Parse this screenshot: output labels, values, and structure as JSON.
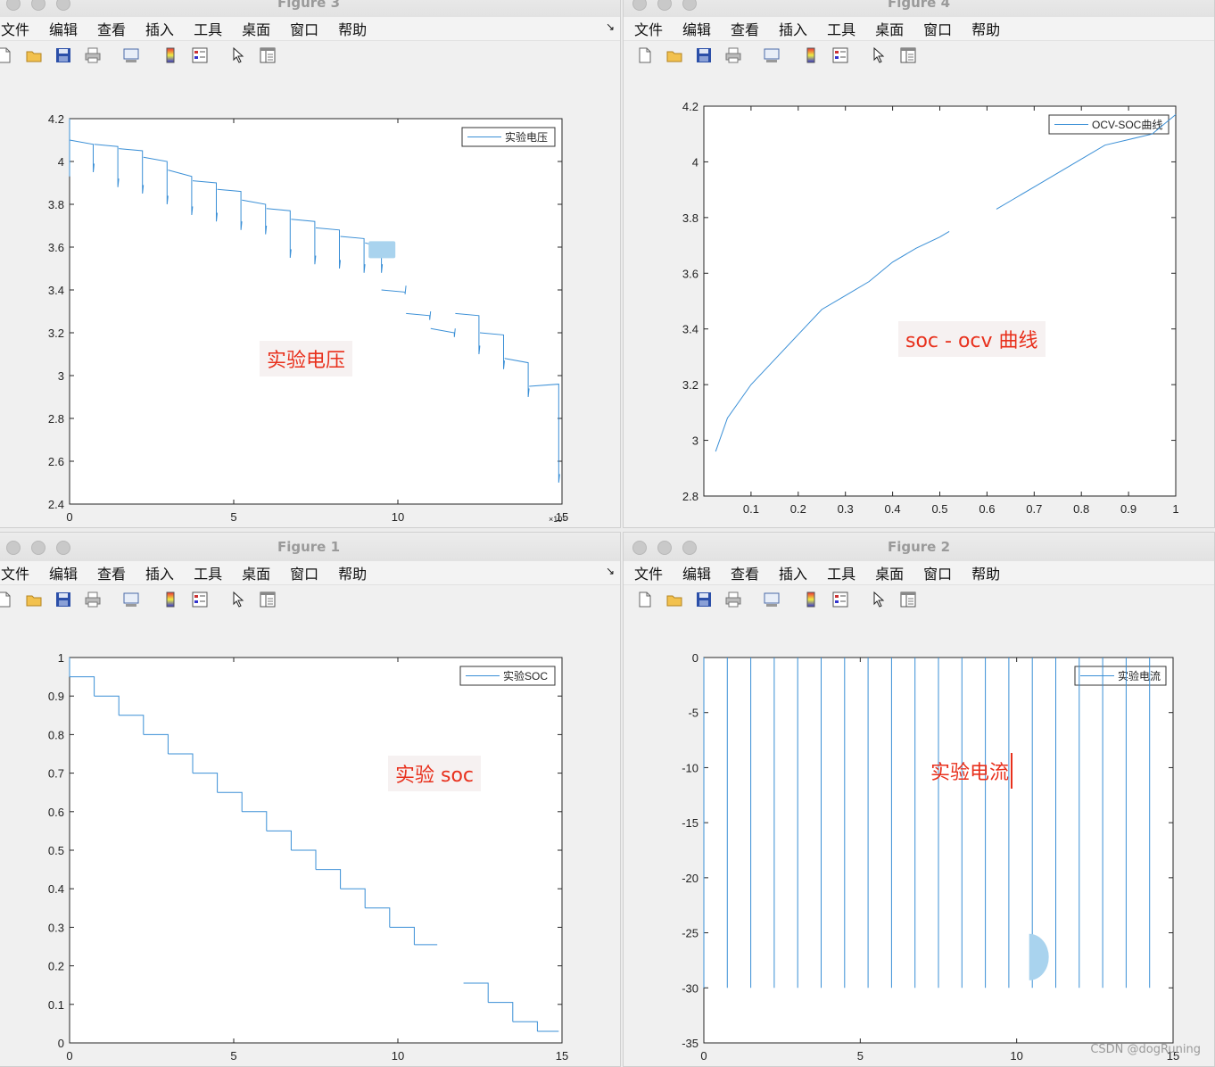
{
  "menu": [
    "文件",
    "编辑",
    "查看",
    "插入",
    "工具",
    "桌面",
    "窗口",
    "帮助"
  ],
  "dock_icon": "↘",
  "toolbar_icons": [
    "new-file-icon",
    "open-folder-icon",
    "save-icon",
    "print-icon",
    "link-icon",
    "colorbar-icon",
    "legend-icon",
    "pointer-icon",
    "property-icon"
  ],
  "colors": {
    "line": "#3a8fd6",
    "annotation": "#e8301c",
    "title": "#9a9a9a"
  },
  "windows": [
    {
      "id": "fig3",
      "title": "Figure 3",
      "legend": "实验电压",
      "annotation": "实验电压",
      "exponent": "×10⁵"
    },
    {
      "id": "fig4",
      "title": "Figure 4",
      "legend": "OCV-SOC曲线",
      "annotation": "soc - ocv 曲线"
    },
    {
      "id": "fig1",
      "title": "Figure 1",
      "legend": "实验SOC",
      "annotation": "实验 soc"
    },
    {
      "id": "fig2",
      "title": "Figure 2",
      "legend": "实验电流",
      "annotation": "实验电流"
    }
  ],
  "watermark": "CSDN @dogRuning",
  "chart_data": [
    {
      "type": "line",
      "figure": "Figure 3",
      "xlim": [
        0,
        15
      ],
      "ylim": [
        2.4,
        4.2
      ],
      "xticks": [
        "0",
        "5",
        "10",
        "15"
      ],
      "yticks": [
        "2.4",
        "2.6",
        "2.8",
        "3",
        "3.2",
        "3.4",
        "3.6",
        "3.8",
        "4",
        "4.2"
      ],
      "series": [
        {
          "name": "实验电压",
          "pulses": [
            [
              0.0,
              4.1,
              4.08,
              3.95
            ],
            [
              0.75,
              4.08,
              4.07,
              3.88
            ],
            [
              1.5,
              4.06,
              4.05,
              3.85
            ],
            [
              2.25,
              4.02,
              4.0,
              3.8
            ],
            [
              3.0,
              3.96,
              3.93,
              3.75
            ],
            [
              3.75,
              3.91,
              3.9,
              3.72
            ],
            [
              4.5,
              3.87,
              3.86,
              3.68
            ],
            [
              5.25,
              3.82,
              3.8,
              3.66
            ],
            [
              6.0,
              3.78,
              3.77,
              3.55
            ],
            [
              6.75,
              3.73,
              3.72,
              3.52
            ],
            [
              7.5,
              3.69,
              3.68,
              3.5
            ],
            [
              8.25,
              3.65,
              3.64,
              3.48
            ],
            [
              9.0,
              3.62,
              3.6,
              3.48
            ],
            [
              9.5,
              3.4,
              3.39,
              3.38
            ],
            [
              10.25,
              3.29,
              3.28,
              3.26
            ],
            [
              11.0,
              3.22,
              3.2,
              3.18
            ],
            [
              11.75,
              3.29,
              3.28,
              3.1
            ],
            [
              12.5,
              3.2,
              3.19,
              3.03
            ],
            [
              13.25,
              3.08,
              3.06,
              2.9
            ],
            [
              14.0,
              2.95,
              2.96,
              2.5
            ]
          ]
        }
      ]
    },
    {
      "type": "line",
      "figure": "Figure 4",
      "xlim": [
        0,
        1
      ],
      "ylim": [
        2.8,
        4.2
      ],
      "xticks": [
        "0.1",
        "0.2",
        "0.3",
        "0.4",
        "0.5",
        "0.6",
        "0.7",
        "0.8",
        "0.9",
        "1"
      ],
      "yticks": [
        "2.8",
        "3",
        "3.2",
        "3.4",
        "3.6",
        "3.8",
        "4",
        "4.2"
      ],
      "series": [
        {
          "name": "OCV-SOC曲线",
          "x": [
            0.025,
            0.05,
            0.1,
            0.15,
            0.2,
            0.25,
            0.3,
            0.35,
            0.4,
            0.45,
            0.5,
            0.52
          ],
          "y": [
            2.96,
            3.08,
            3.2,
            3.29,
            3.38,
            3.47,
            3.52,
            3.57,
            3.64,
            3.69,
            3.73,
            3.75
          ],
          "x2": [
            0.62,
            0.65,
            0.7,
            0.75,
            0.8,
            0.85,
            0.9,
            0.95,
            1.0
          ],
          "y2": [
            3.83,
            3.86,
            3.91,
            3.96,
            4.01,
            4.06,
            4.08,
            4.1,
            4.17
          ]
        }
      ]
    },
    {
      "type": "line",
      "figure": "Figure 1",
      "xlim": [
        0,
        15
      ],
      "ylim": [
        0,
        1
      ],
      "xticks": [
        "0",
        "5",
        "10",
        "15"
      ],
      "yticks": [
        "0",
        "0.1",
        "0.2",
        "0.3",
        "0.4",
        "0.5",
        "0.6",
        "0.7",
        "0.8",
        "0.9",
        "1"
      ],
      "series": [
        {
          "name": "实验SOC",
          "steps": [
            [
              0,
              0.95
            ],
            [
              0.75,
              0.9
            ],
            [
              1.5,
              0.85
            ],
            [
              2.25,
              0.8
            ],
            [
              3.0,
              0.75
            ],
            [
              3.75,
              0.7
            ],
            [
              4.5,
              0.65
            ],
            [
              5.25,
              0.6
            ],
            [
              6.0,
              0.55
            ],
            [
              6.75,
              0.5
            ],
            [
              7.5,
              0.45
            ],
            [
              8.25,
              0.4
            ],
            [
              9.0,
              0.35
            ],
            [
              9.75,
              0.3
            ],
            [
              10.5,
              0.255
            ],
            [
              11.2,
              null
            ],
            [
              12.0,
              0.155
            ],
            [
              12.75,
              0.105
            ],
            [
              13.5,
              0.055
            ],
            [
              14.25,
              0.03
            ],
            [
              14.9,
              0.03
            ]
          ]
        }
      ]
    },
    {
      "type": "line",
      "figure": "Figure 2",
      "xlim": [
        0,
        15
      ],
      "ylim": [
        -35,
        0
      ],
      "xticks": [
        "0",
        "5",
        "10",
        "15"
      ],
      "yticks": [
        "0",
        "-5",
        "-10",
        "-15",
        "-20",
        "-25",
        "-30",
        "-35"
      ],
      "series": [
        {
          "name": "实验电流",
          "pulse_x": [
            0.0,
            0.75,
            1.5,
            2.25,
            3.0,
            3.75,
            4.5,
            5.25,
            6.0,
            6.75,
            7.5,
            8.25,
            9.0,
            9.75,
            10.5,
            11.25,
            12.0,
            12.75,
            13.5,
            14.25
          ],
          "pulse_value": -30
        }
      ]
    }
  ]
}
